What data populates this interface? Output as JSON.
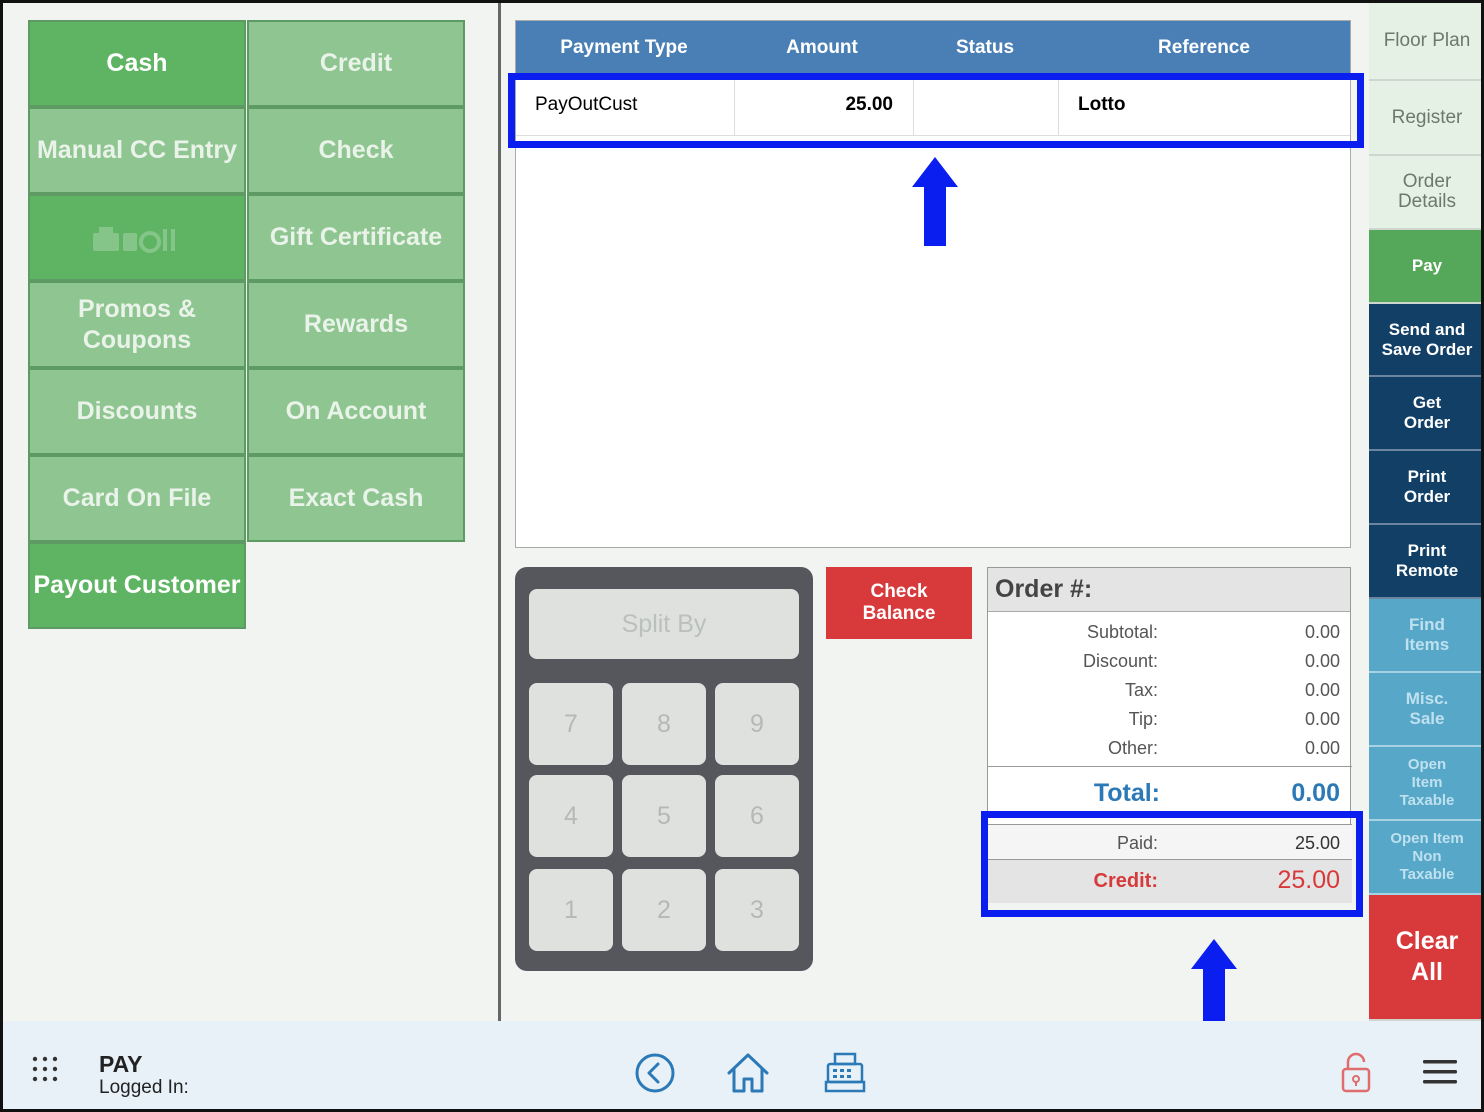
{
  "payment_buttons": [
    {
      "label": "Cash",
      "state": "active"
    },
    {
      "label": "Credit",
      "state": "normal"
    },
    {
      "label": "Manual CC Entry",
      "state": "normal"
    },
    {
      "label": "Check",
      "state": "normal"
    },
    {
      "label": "",
      "state": "dim",
      "icon": "gift-card-logo-icon"
    },
    {
      "label": "Gift Certificate",
      "state": "normal"
    },
    {
      "label": "Promos & Coupons",
      "state": "normal"
    },
    {
      "label": "Rewards",
      "state": "normal"
    },
    {
      "label": "Discounts",
      "state": "normal"
    },
    {
      "label": "On Account",
      "state": "normal"
    },
    {
      "label": "Card On File",
      "state": "normal"
    },
    {
      "label": "Exact Cash",
      "state": "normal"
    },
    {
      "label": "Payout Customer",
      "state": "active"
    }
  ],
  "payments_table": {
    "headers": [
      "Payment Type",
      "Amount",
      "Status",
      "Reference"
    ],
    "rows": [
      {
        "type": "PayOutCust",
        "amount": "25.00",
        "status": "",
        "reference": "Lotto"
      }
    ]
  },
  "keypad": {
    "split_by": "Split By",
    "keys": [
      "7",
      "8",
      "9",
      "4",
      "5",
      "6",
      "1",
      "2",
      "3"
    ]
  },
  "check_balance": "Check Balance",
  "order": {
    "title": "Order #:",
    "lines": [
      {
        "label": "Subtotal:",
        "value": "0.00"
      },
      {
        "label": "Discount:",
        "value": "0.00"
      },
      {
        "label": "Tax:",
        "value": "0.00"
      },
      {
        "label": "Tip:",
        "value": "0.00"
      },
      {
        "label": "Other:",
        "value": "0.00"
      }
    ],
    "total_label": "Total:",
    "total_value": "0.00",
    "paid_label": "Paid:",
    "paid_value": "25.00",
    "credit_label": "Credit:",
    "credit_value": "25.00"
  },
  "right_nav": [
    {
      "label": "Floor Plan",
      "style": "light"
    },
    {
      "label": "Register",
      "style": "light"
    },
    {
      "label": "Order Details",
      "style": "light"
    },
    {
      "label": "Pay",
      "style": "green"
    },
    {
      "label": "Send and Save Order",
      "style": "navy"
    },
    {
      "label": "Get Order",
      "style": "navy"
    },
    {
      "label": "Print Order",
      "style": "navy"
    },
    {
      "label": "Print Remote",
      "style": "navy"
    },
    {
      "label": "Find Items",
      "style": "teal"
    },
    {
      "label": "Misc. Sale",
      "style": "teal"
    },
    {
      "label": "Open Item Taxable",
      "style": "teal"
    },
    {
      "label": "Open Item Non Taxable",
      "style": "teal"
    },
    {
      "label": "Clear All",
      "style": "red"
    }
  ],
  "bottom_bar": {
    "title": "PAY",
    "logged_in": "Logged In:",
    "icons": [
      "apps-grid-icon",
      "back-icon",
      "home-icon",
      "register-icon",
      "lock-icon",
      "menu-icon"
    ]
  },
  "colors": {
    "accent_blue": "#4a7fb5",
    "green_active": "#5eb462",
    "green_normal": "#8fc590",
    "navy": "#113f66",
    "teal": "#56a7c8",
    "red": "#d8393b",
    "highlight": "#0a1fef"
  }
}
